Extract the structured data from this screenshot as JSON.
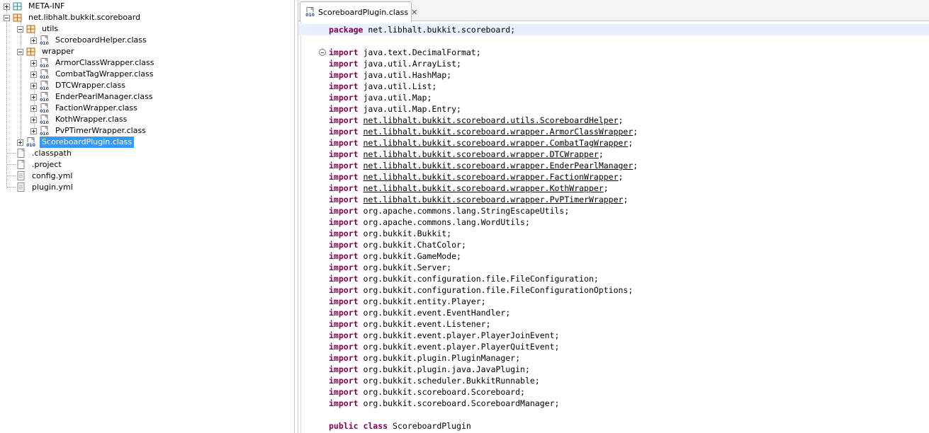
{
  "tree": {
    "items": [
      {
        "label": "META-INF",
        "icon": "folder-icon",
        "expanded": false,
        "selected": false
      },
      {
        "label": "net.libhalt.bukkit.scoreboard",
        "icon": "package-icon",
        "expanded": true,
        "selected": false
      },
      {
        "label": "utils",
        "icon": "package-icon",
        "expanded": true,
        "selected": false
      },
      {
        "label": "ScoreboardHelper.class",
        "icon": "class-file-icon",
        "expanded": false,
        "selected": false
      },
      {
        "label": "wrapper",
        "icon": "package-icon",
        "expanded": true,
        "selected": false
      },
      {
        "label": "ArmorClassWrapper.class",
        "icon": "class-file-icon",
        "expanded": false,
        "selected": false
      },
      {
        "label": "CombatTagWrapper.class",
        "icon": "class-file-icon",
        "expanded": false,
        "selected": false
      },
      {
        "label": "DTCWrapper.class",
        "icon": "class-file-icon",
        "expanded": false,
        "selected": false
      },
      {
        "label": "EnderPearlManager.class",
        "icon": "class-file-icon",
        "expanded": false,
        "selected": false
      },
      {
        "label": "FactionWrapper.class",
        "icon": "class-file-icon",
        "expanded": false,
        "selected": false
      },
      {
        "label": "KothWrapper.class",
        "icon": "class-file-icon",
        "expanded": false,
        "selected": false
      },
      {
        "label": "PvPTimerWrapper.class",
        "icon": "class-file-icon",
        "expanded": false,
        "selected": false
      },
      {
        "label": "ScoreboardPlugin.class",
        "icon": "class-file-icon",
        "expanded": false,
        "selected": true
      },
      {
        "label": ".classpath",
        "icon": "file-icon",
        "expanded": false,
        "selected": false
      },
      {
        "label": ".project",
        "icon": "file-icon",
        "expanded": false,
        "selected": false
      },
      {
        "label": "config.yml",
        "icon": "text-file-icon",
        "expanded": false,
        "selected": false
      },
      {
        "label": "plugin.yml",
        "icon": "text-file-icon",
        "expanded": false,
        "selected": false
      }
    ]
  },
  "editor": {
    "tab": {
      "label": "ScoreboardPlugin.class",
      "close": "✕",
      "icon": "class-file-icon"
    },
    "lines": [
      {
        "kw": "package",
        "text": " net.libhalt.bukkit.scoreboard;",
        "link": false
      },
      {
        "kw": "",
        "text": "",
        "link": false
      },
      {
        "kw": "import",
        "text": " java.text.DecimalFormat;",
        "link": false
      },
      {
        "kw": "import",
        "text": " java.util.ArrayList;",
        "link": false
      },
      {
        "kw": "import",
        "text": " java.util.HashMap;",
        "link": false
      },
      {
        "kw": "import",
        "text": " java.util.List;",
        "link": false
      },
      {
        "kw": "import",
        "text": " java.util.Map;",
        "link": false
      },
      {
        "kw": "import",
        "text": " java.util.Map.Entry;",
        "link": false
      },
      {
        "kw": "import",
        "text": "net.libhalt.bukkit.scoreboard.utils.ScoreboardHelper",
        "link": true
      },
      {
        "kw": "import",
        "text": "net.libhalt.bukkit.scoreboard.wrapper.ArmorClassWrapper",
        "link": true
      },
      {
        "kw": "import",
        "text": "net.libhalt.bukkit.scoreboard.wrapper.CombatTagWrapper",
        "link": true
      },
      {
        "kw": "import",
        "text": "net.libhalt.bukkit.scoreboard.wrapper.DTCWrapper",
        "link": true
      },
      {
        "kw": "import",
        "text": "net.libhalt.bukkit.scoreboard.wrapper.EnderPearlManager",
        "link": true
      },
      {
        "kw": "import",
        "text": "net.libhalt.bukkit.scoreboard.wrapper.FactionWrapper",
        "link": true
      },
      {
        "kw": "import",
        "text": "net.libhalt.bukkit.scoreboard.wrapper.KothWrapper",
        "link": true
      },
      {
        "kw": "import",
        "text": "net.libhalt.bukkit.scoreboard.wrapper.PvPTimerWrapper",
        "link": true
      },
      {
        "kw": "import",
        "text": " org.apache.commons.lang.StringEscapeUtils;",
        "link": false
      },
      {
        "kw": "import",
        "text": " org.apache.commons.lang.WordUtils;",
        "link": false
      },
      {
        "kw": "import",
        "text": " org.bukkit.Bukkit;",
        "link": false
      },
      {
        "kw": "import",
        "text": " org.bukkit.ChatColor;",
        "link": false
      },
      {
        "kw": "import",
        "text": " org.bukkit.GameMode;",
        "link": false
      },
      {
        "kw": "import",
        "text": " org.bukkit.Server;",
        "link": false
      },
      {
        "kw": "import",
        "text": " org.bukkit.configuration.file.FileConfiguration;",
        "link": false
      },
      {
        "kw": "import",
        "text": " org.bukkit.configuration.file.FileConfigurationOptions;",
        "link": false
      },
      {
        "kw": "import",
        "text": " org.bukkit.entity.Player;",
        "link": false
      },
      {
        "kw": "import",
        "text": " org.bukkit.event.EventHandler;",
        "link": false
      },
      {
        "kw": "import",
        "text": " org.bukkit.event.Listener;",
        "link": false
      },
      {
        "kw": "import",
        "text": " org.bukkit.event.player.PlayerJoinEvent;",
        "link": false
      },
      {
        "kw": "import",
        "text": " org.bukkit.event.player.PlayerQuitEvent;",
        "link": false
      },
      {
        "kw": "import",
        "text": " org.bukkit.plugin.PluginManager;",
        "link": false
      },
      {
        "kw": "import",
        "text": " org.bukkit.plugin.java.JavaPlugin;",
        "link": false
      },
      {
        "kw": "import",
        "text": " org.bukkit.scheduler.BukkitRunnable;",
        "link": false
      },
      {
        "kw": "import",
        "text": " org.bukkit.scoreboard.Scoreboard;",
        "link": false
      },
      {
        "kw": "import",
        "text": " org.bukkit.scoreboard.ScoreboardManager;",
        "link": false
      },
      {
        "kw": "",
        "text": "",
        "link": false
      },
      {
        "kw": "public class",
        "text": " ScoreboardPlugin",
        "link": false
      }
    ]
  },
  "colors": {
    "keyword": "#7f0055",
    "selection": "#3399ff",
    "current_line": "#e8f2fe"
  }
}
